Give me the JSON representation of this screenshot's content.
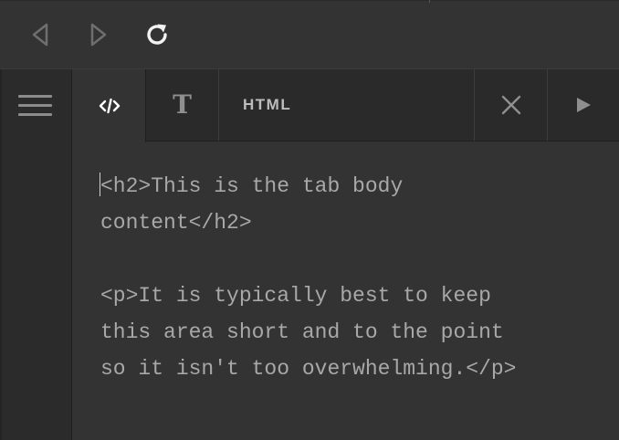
{
  "toolbar": {
    "back_icon": "triangle-left-outline-icon",
    "forward_icon": "triangle-right-outline-icon",
    "reload_icon": "reload-icon"
  },
  "sidebar": {
    "menu_icon": "hamburger-menu-icon"
  },
  "tabs": [
    {
      "icon": "code-icon",
      "active": true
    },
    {
      "icon": "text-icon",
      "glyph": "T",
      "active": false
    },
    {
      "label": "HTML",
      "active": false
    }
  ],
  "tab_actions": {
    "close_icon": "close-icon",
    "run_icon": "play-icon"
  },
  "editor": {
    "content": "<h2>This is the tab body\ncontent</h2>\n\n<p>It is typically best to keep\nthis area short and to the point\nso it isn't too overwhelming.</p>"
  },
  "colors": {
    "background": "#333333",
    "sidebar": "#2b2b2b",
    "tabbar": "#2a2a2a",
    "text": "#a8a8a8",
    "icon": "#8c8c8c"
  }
}
